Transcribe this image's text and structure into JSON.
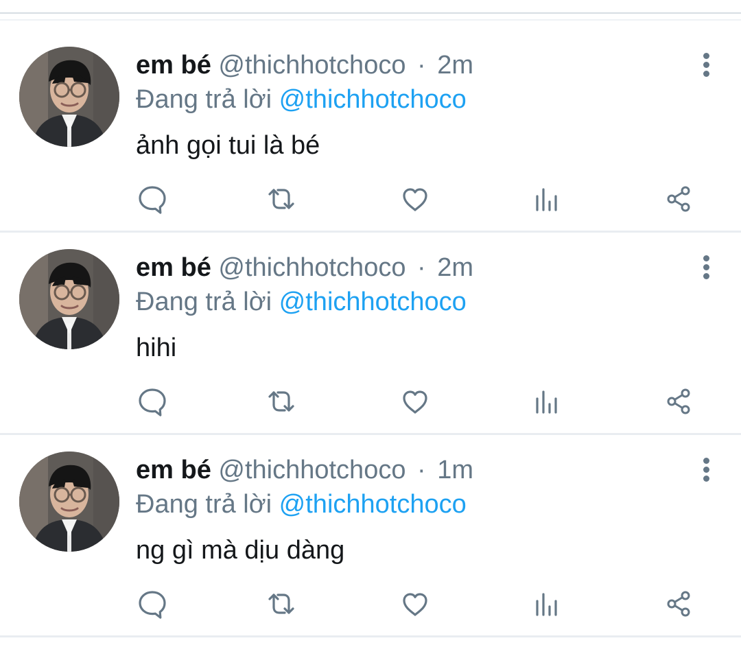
{
  "tweets": [
    {
      "display_name": "em bé",
      "handle": "@thichhotchoco",
      "separator": "·",
      "time": "2m",
      "reply_prefix": "Đang trả lời",
      "reply_handle": "@thichhotchoco",
      "text": "ảnh gọi tui là bé"
    },
    {
      "display_name": "em bé",
      "handle": "@thichhotchoco",
      "separator": "·",
      "time": "2m",
      "reply_prefix": "Đang trả lời",
      "reply_handle": "@thichhotchoco",
      "text": "hihi"
    },
    {
      "display_name": "em bé",
      "handle": "@thichhotchoco",
      "separator": "·",
      "time": "1m",
      "reply_prefix": "Đang trả lời",
      "reply_handle": "@thichhotchoco",
      "text": "ng gì mà dịu dàng"
    }
  ],
  "icons": {
    "reply": "comment-icon",
    "retweet": "retweet-icon",
    "like": "heart-icon",
    "analytics": "analytics-icon",
    "share": "share-icon",
    "more": "more-vertical-icon"
  },
  "colors": {
    "text_primary": "#14171a",
    "text_secondary": "#657786",
    "link": "#1da1f2",
    "divider": "#e9edf1"
  }
}
